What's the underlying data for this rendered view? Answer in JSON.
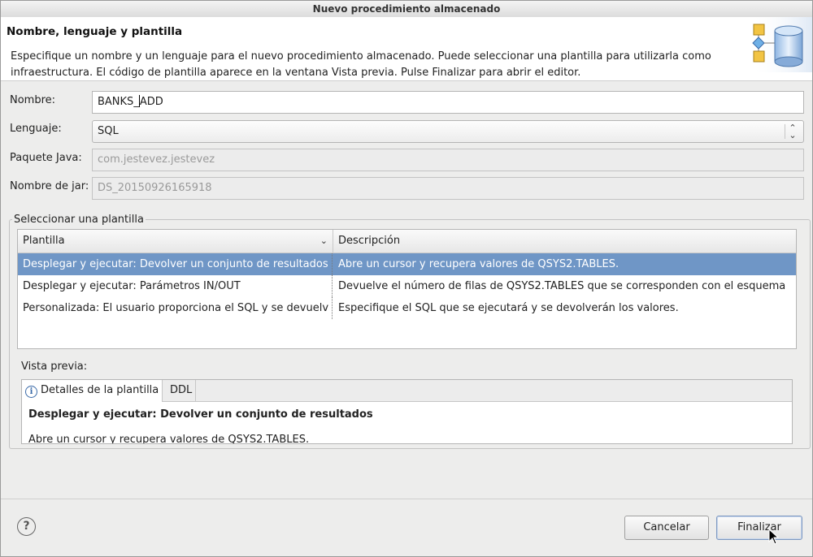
{
  "window": {
    "title": "Nuevo procedimiento almacenado"
  },
  "header": {
    "title": "Nombre, lenguaje y plantilla",
    "description": "Especifique un nombre y un lenguaje para el nuevo procedimiento almacenado. Puede seleccionar una plantilla para utilizarla como infraestructura. El código de plantilla aparece en la ventana Vista previa. Pulse Finalizar para abrir el editor."
  },
  "form": {
    "name_label": "Nombre:",
    "name_value_before_caret": "BANKS_",
    "name_value_after_caret": "ADD",
    "language_label": "Lenguaje:",
    "language_value": "SQL",
    "package_label": "Paquete Java:",
    "package_value": "com.jestevez.jestevez",
    "jar_label": "Nombre de jar:",
    "jar_value": "DS_20150926165918"
  },
  "templates": {
    "group_label": "Seleccionar una plantilla",
    "columns": [
      "Plantilla",
      "Descripción"
    ],
    "rows": [
      {
        "template": "Desplegar y ejecutar: Devolver un conjunto de resultados",
        "description": "Abre un cursor y recupera valores de QSYS2.TABLES.",
        "selected": true
      },
      {
        "template": "Desplegar y ejecutar: Parámetros IN/OUT",
        "description": "Devuelve el número de filas de QSYS2.TABLES que se corresponden con el esquema",
        "selected": false
      },
      {
        "template": "Personalizada: El usuario proporciona el SQL y se devuelv",
        "description": "Especifique el SQL que se ejecutará y se devolverán los valores.",
        "selected": false
      }
    ]
  },
  "preview": {
    "label": "Vista previa:",
    "tabs": [
      "Detalles de la plantilla",
      "DDL"
    ],
    "title": "Desplegar y ejecutar: Devolver un conjunto de resultados",
    "text": "Abre un cursor y recupera valores de QSYS2.TABLES."
  },
  "buttons": {
    "help": "?",
    "cancel": "Cancelar",
    "finish": "Finalizar"
  },
  "colors": {
    "selection": "#6f96c6",
    "window_bg": "#ededec",
    "header_bg": "#ffffff"
  },
  "icons": [
    "wizard-stored-procedure-icon",
    "sort-chevron-icon",
    "combo-arrows-icon",
    "info-icon",
    "help-icon",
    "mouse-pointer-icon"
  ]
}
